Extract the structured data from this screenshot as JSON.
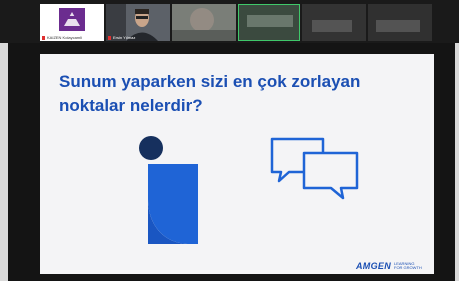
{
  "participants": [
    {
      "name": "KAIZEN Kolaycamli",
      "kind": "logo"
    },
    {
      "name": "Ersin Yılmaz",
      "kind": "video"
    },
    {
      "name": "",
      "kind": "video-blurred"
    },
    {
      "name": "",
      "kind": "video-blurred-active"
    },
    {
      "name": "",
      "kind": "video-blurred"
    },
    {
      "name": "",
      "kind": "video-blurred"
    }
  ],
  "slide": {
    "title_line1": "Sunum yaparken sizi en çok zorlayan",
    "title_line2": "noktalar nelerdir?",
    "brand": "AMGEN",
    "brand_tag_line1": "LEARNING",
    "brand_tag_line2": "FOR GROWTH"
  },
  "colors": {
    "brand_blue": "#1b4fb3",
    "icon_blue": "#1f64d6",
    "icon_navy": "#16305e",
    "slide_bg": "#f4f4f6",
    "active_speaker_border": "#3fc86a"
  },
  "icons": [
    "person-shape-icon",
    "chat-bubbles-icon",
    "muted-mic-icon"
  ]
}
